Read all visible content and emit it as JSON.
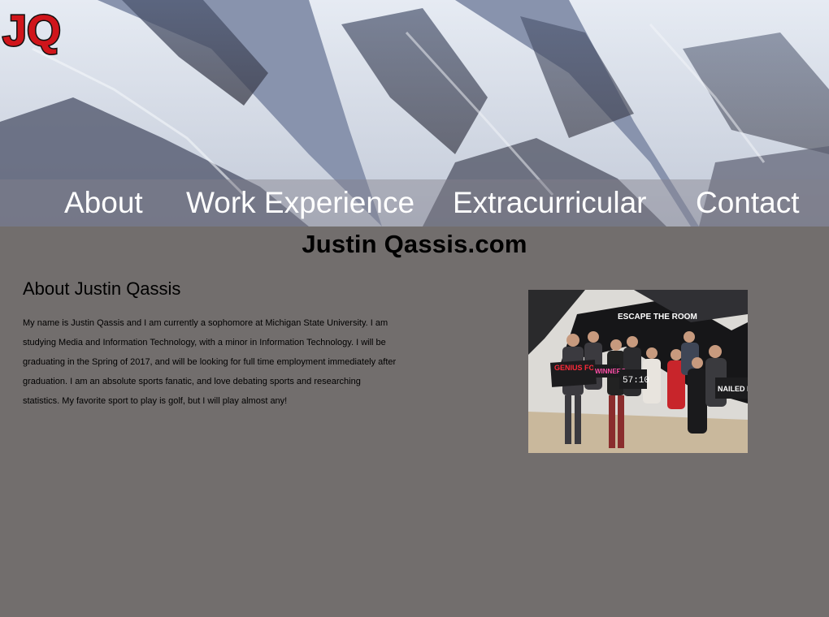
{
  "logo": {
    "text": "JQ",
    "colors": {
      "fill": "#d0151b",
      "outline": "#111111"
    }
  },
  "nav": {
    "items": [
      {
        "label": "About"
      },
      {
        "label": "Work Experience"
      },
      {
        "label": "Extracurricular"
      },
      {
        "label": "Contact"
      }
    ]
  },
  "site_title": "Justin Qassis.com",
  "about": {
    "heading": "About Justin Qassis",
    "body": "My name is Justin Qassis and I am currently a sophomore at Michigan State University. I am studying Media and Information Technology, with a minor in Information Technology. I will be graduating in the Spring of 2017, and will be looking for full time employment immediately after graduation. I am an absolute sports fanatic, and love debating sports and researching statistics. My favorite sport to play is golf, but I will play almost any!"
  },
  "photo": {
    "signs": [
      "ESCAPE THE ROOM",
      "GENIUS FOR HIRE",
      "WINNERS",
      "57:10",
      "NAILED IT"
    ]
  },
  "colors": {
    "page_background": "#726e6d",
    "nav_text": "#ffffff",
    "text": "#000000"
  }
}
